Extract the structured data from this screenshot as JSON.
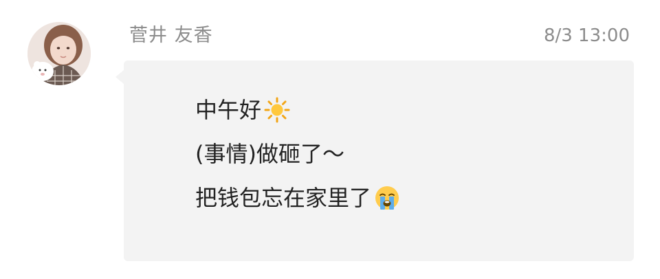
{
  "message": {
    "sender_name": "菅井 友香",
    "timestamp": "8/3 13:00",
    "lines": [
      {
        "text": "中午好",
        "emoji": "sun-emoji"
      },
      {
        "text": "(事情)做砸了～",
        "emoji": ""
      },
      {
        "text": "把钱包忘在家里了",
        "emoji": "loudly-crying-face-emoji"
      }
    ]
  },
  "colors": {
    "background": "#ffffff",
    "bubble": "#f3f3f3",
    "meta_text": "#8c8c8c",
    "message_text": "#222222"
  }
}
